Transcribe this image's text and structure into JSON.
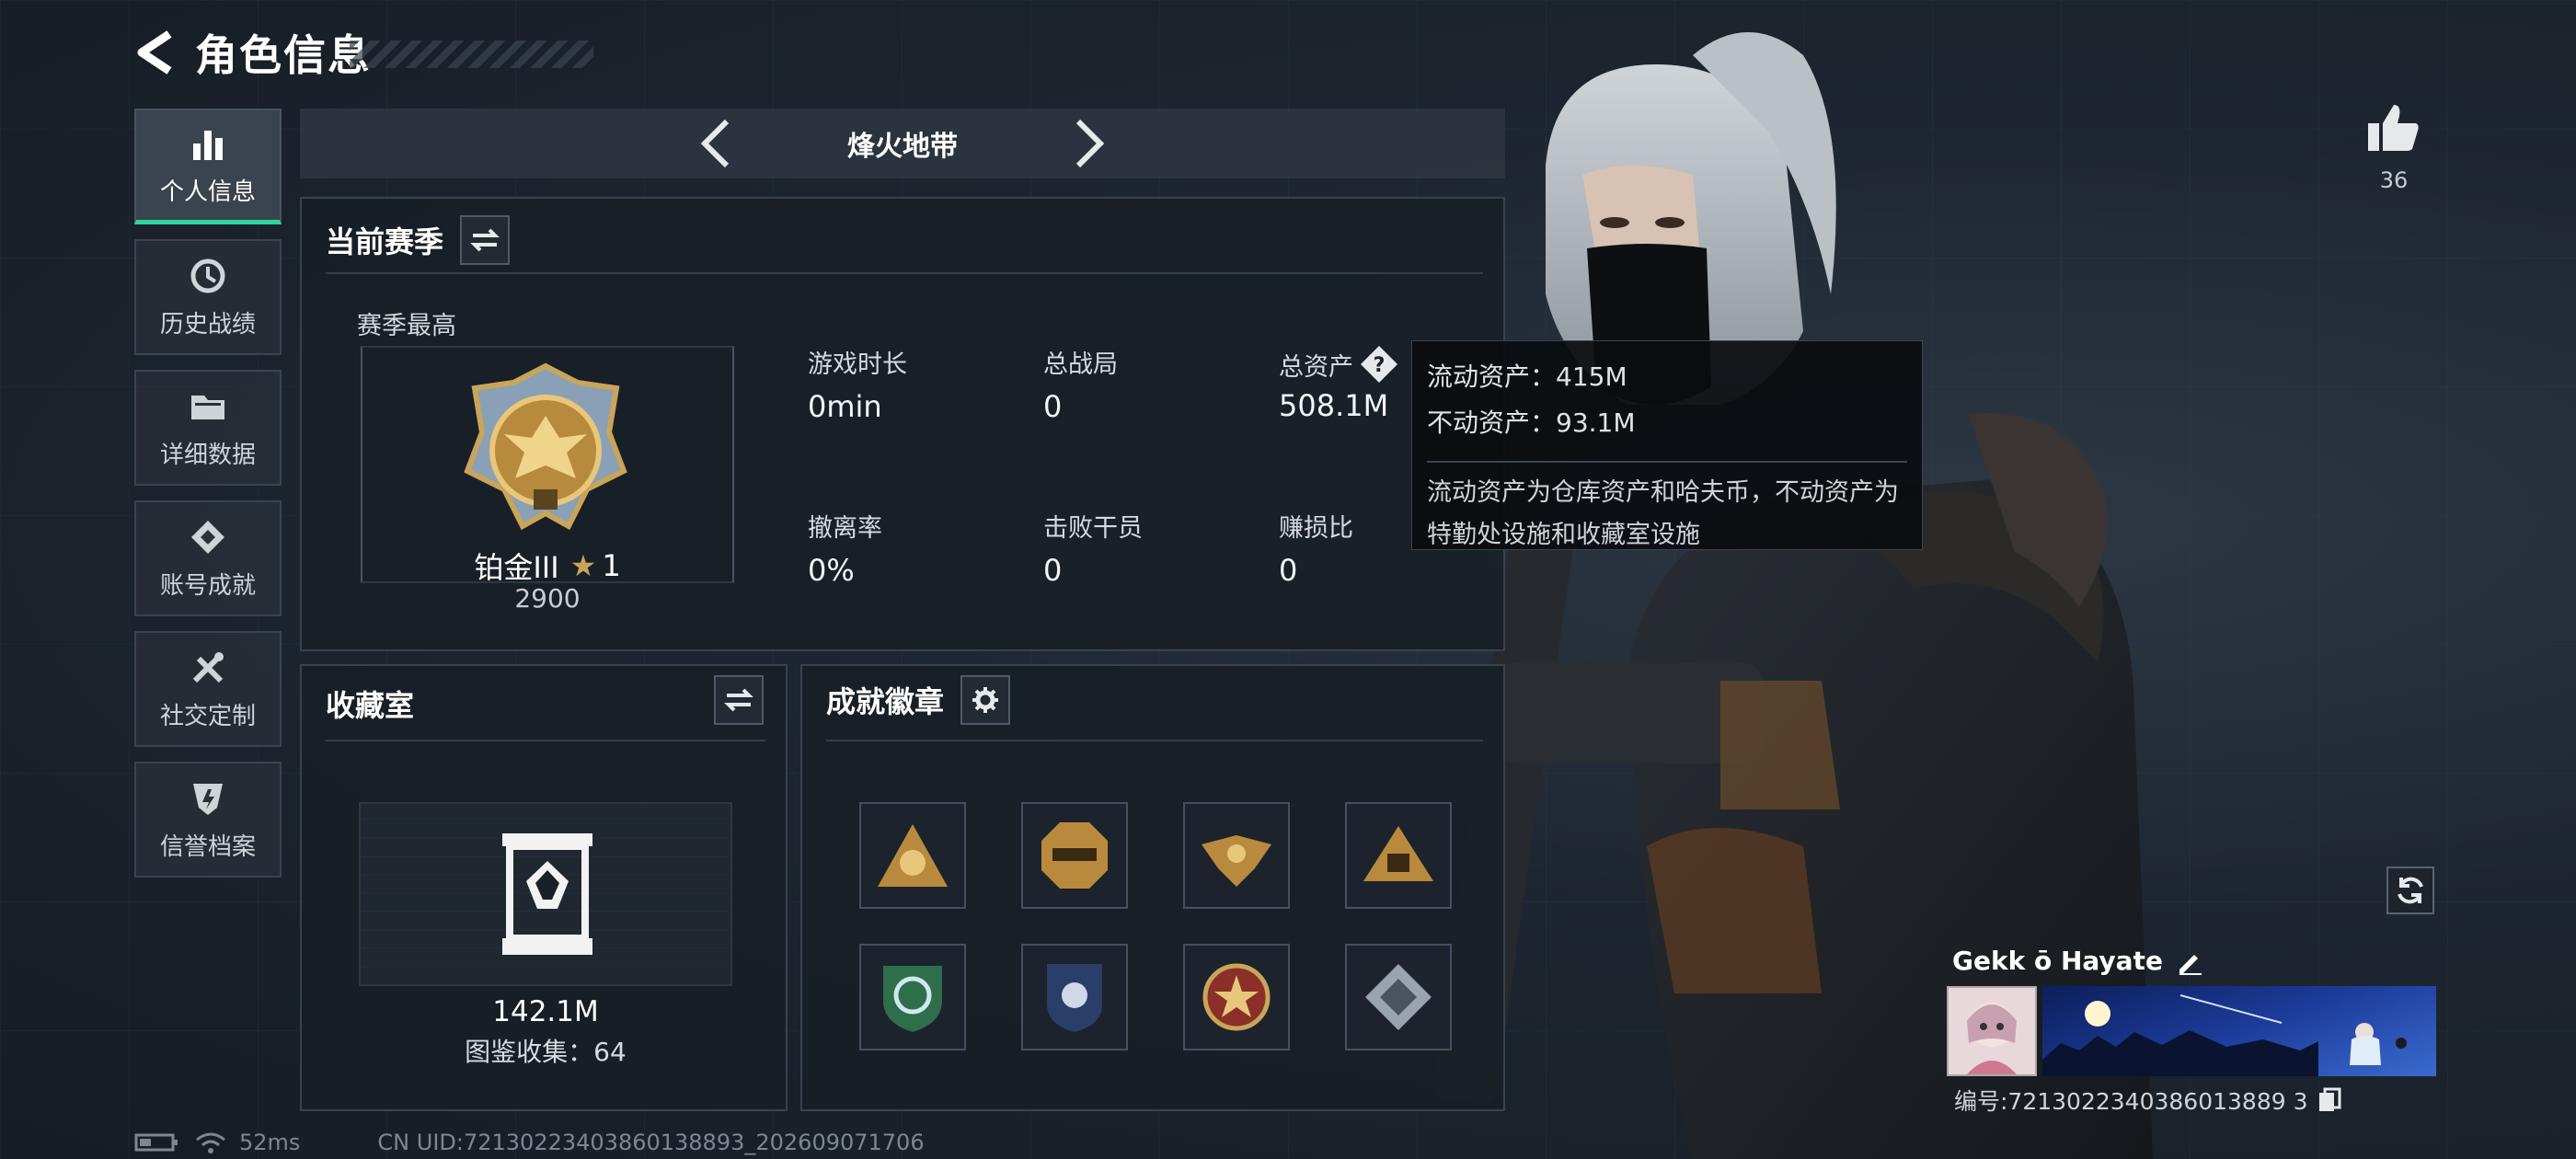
{
  "header": {
    "title": "角色信息"
  },
  "sidebar": {
    "items": [
      {
        "label": "个人信息",
        "icon": "bar-chart-icon",
        "active": true
      },
      {
        "label": "历史战绩",
        "icon": "history-clock-icon"
      },
      {
        "label": "详细数据",
        "icon": "folder-icon"
      },
      {
        "label": "账号成就",
        "icon": "achievement-diamond-icon"
      },
      {
        "label": "社交定制",
        "icon": "wrench-screwdriver-icon"
      },
      {
        "label": "信誉档案",
        "icon": "shield-badge-icon"
      }
    ]
  },
  "mode_selector": {
    "name": "烽火地带"
  },
  "current_season": {
    "title": "当前赛季",
    "highest_label": "赛季最高",
    "rank_name": "铂金III",
    "rank_stars": "1",
    "rank_score": "2900",
    "stats": [
      {
        "label": "游戏时长",
        "value": "0min"
      },
      {
        "label": "总战局",
        "value": "0"
      },
      {
        "label": "总资产",
        "value": "508.1M"
      },
      {
        "label": "撤离率",
        "value": "0%"
      },
      {
        "label": "击败干员",
        "value": "0"
      },
      {
        "label": "赚损比",
        "value": "0"
      }
    ]
  },
  "tooltip": {
    "liquid": "流动资产：415M",
    "fixed": "不动资产：93.1M",
    "desc": "流动资产为仓库资产和哈夫币，不动资产为特勤处设施和收藏室设施"
  },
  "collection": {
    "title": "收藏室",
    "value": "142.1M",
    "catalog": "图鉴收集：64"
  },
  "achievements": {
    "title": "成就徽章",
    "badges": [
      "badge-1",
      "badge-2",
      "badge-3",
      "badge-4",
      "badge-5",
      "badge-6",
      "badge-7",
      "badge-8"
    ]
  },
  "profile": {
    "likes": "36",
    "player_name": "Gekk ō Hayate",
    "uid": "编号:7213022340386013889 3"
  },
  "footer": {
    "ping": "52ms",
    "cn_uid": "CN UID:72130223403860138893_202609071706"
  },
  "colors": {
    "accent": "#2fd49a",
    "gold": "#c8a55a",
    "panel": "#1d242d"
  }
}
